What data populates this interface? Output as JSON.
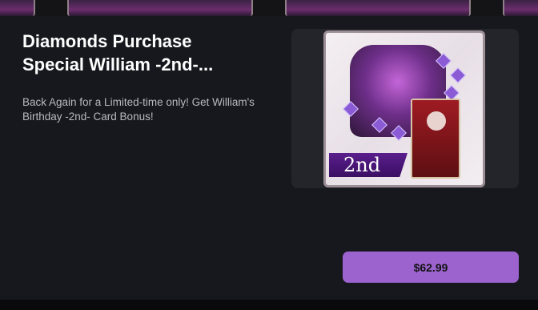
{
  "offer": {
    "title": "Diamonds Purchase\nSpecial William -2nd-...",
    "description": "Back Again for a Limited-time only! Get William's Birthday -2nd- Card Bonus!",
    "badge_text": "2nd",
    "price_label": "$62.99"
  },
  "colors": {
    "background": "#0d0d10",
    "card": "#17181d",
    "accent": "#9c63cf",
    "thumbnail_bg": "#24252b"
  }
}
